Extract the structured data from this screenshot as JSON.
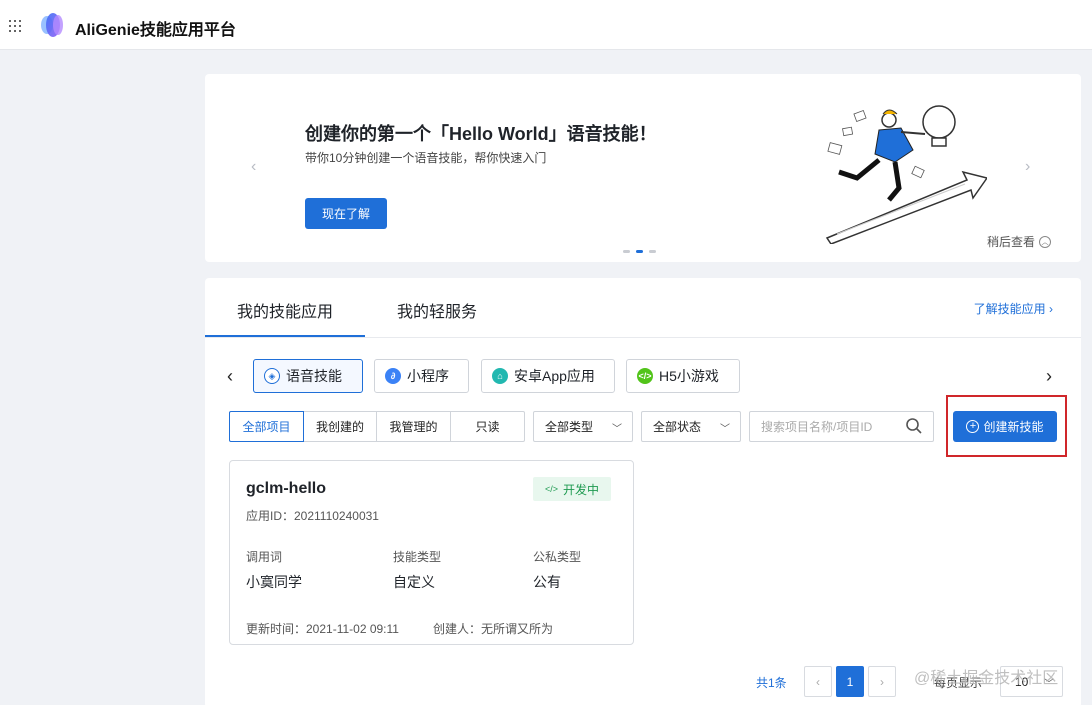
{
  "header": {
    "title": "AliGenie技能应用平台"
  },
  "banner": {
    "title": "创建你的第一个「Hello World」语音技能！",
    "subtitle": "带你10分钟创建一个语音技能，帮你快速入门",
    "cta_label": "现在了解",
    "later_label": "稍后查看",
    "slide_count": 3,
    "active_slide": 2
  },
  "tabs": [
    {
      "label": "我的技能应用",
      "active": true
    },
    {
      "label": "我的轻服务",
      "active": false
    }
  ],
  "learn_link": "了解技能应用 ›",
  "categories": [
    {
      "label": "语音技能",
      "icon": "cube-icon",
      "color": "#1f6fd8",
      "active": true
    },
    {
      "label": "小程序",
      "icon": "mini-program-icon",
      "color": "#3b82f6",
      "active": false
    },
    {
      "label": "安卓App应用",
      "icon": "android-icon",
      "color": "#22b8b0",
      "active": false
    },
    {
      "label": "H5小游戏",
      "icon": "code-icon",
      "color": "#52c41a",
      "active": false
    }
  ],
  "filters": {
    "segments": [
      {
        "label": "全部项目",
        "active": true
      },
      {
        "label": "我创建的",
        "active": false
      },
      {
        "label": "我管理的",
        "active": false
      },
      {
        "label": "只读",
        "active": false
      }
    ],
    "type_select": "全部类型",
    "status_select": "全部状态",
    "search_placeholder": "搜索项目名称/项目ID",
    "create_label": "创建新技能"
  },
  "cards": [
    {
      "name": "gclm-hello",
      "status": "开发中",
      "id_label": "应用ID：2021110240031",
      "invoke_label": "调用词",
      "invoke_value": "小寞同学",
      "type_label": "技能类型",
      "type_value": "自定义",
      "privacy_label": "公私类型",
      "privacy_value": "公有",
      "updated": "更新时间：2021-11-02 09:11",
      "creator": "创建人：无所谓又所为"
    }
  ],
  "pagination": {
    "total": "共1条",
    "current": "1",
    "per_page_label": "每页显示",
    "page_size": "10"
  },
  "watermark": "@稀土掘金技术社区"
}
